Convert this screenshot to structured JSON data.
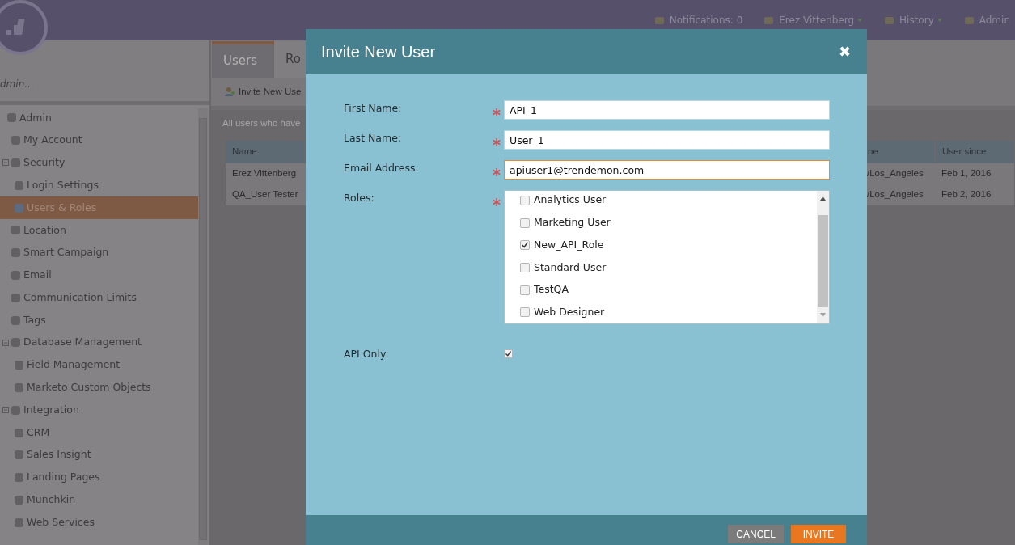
{
  "top_bar": {
    "items": [
      {
        "label": "Notifications: 0",
        "dropdown": false
      },
      {
        "label": "Erez Vittenberg",
        "dropdown": true
      },
      {
        "label": "History",
        "dropdown": true
      },
      {
        "label": "Admin",
        "dropdown": false
      }
    ]
  },
  "sidebar": {
    "search_placeholder": "dmin...",
    "tree": [
      {
        "label": "Admin",
        "selected": false,
        "children": [
          {
            "label": "My Account",
            "selected": false
          },
          {
            "label": "Security",
            "selected": false,
            "expanded": true,
            "children": [
              {
                "label": "Login Settings",
                "selected": false
              },
              {
                "label": "Users & Roles",
                "selected": true
              }
            ]
          },
          {
            "label": "Location",
            "selected": false
          },
          {
            "label": "Smart Campaign",
            "selected": false
          },
          {
            "label": "Email",
            "selected": false
          },
          {
            "label": "Communication Limits",
            "selected": false
          },
          {
            "label": "Tags",
            "selected": false
          },
          {
            "label": "Database Management",
            "selected": false,
            "expanded": true,
            "children": [
              {
                "label": "Field Management",
                "selected": false
              },
              {
                "label": "Marketo Custom Objects",
                "selected": false
              }
            ]
          },
          {
            "label": "Integration",
            "selected": false,
            "expanded": true,
            "children": [
              {
                "label": "CRM",
                "selected": false
              },
              {
                "label": "Sales Insight",
                "selected": false
              },
              {
                "label": "Landing Pages",
                "selected": false
              },
              {
                "label": "Munchkin",
                "selected": false
              },
              {
                "label": "Web Services",
                "selected": false
              }
            ]
          }
        ]
      }
    ]
  },
  "tabs": [
    {
      "label": "Users",
      "selected": true
    },
    {
      "label": "Ro",
      "selected": false
    }
  ],
  "toolbar": {
    "invite_button": "Invite New Use"
  },
  "description": "All users who have",
  "table": {
    "columns": [
      "Name",
      "ne",
      "User since"
    ],
    "rows": [
      [
        "Erez Vittenberg",
        "/Los_Angeles",
        "Feb 1, 2016"
      ],
      [
        "QA_User Tester",
        "/Los_Angeles",
        "Feb 2, 2016"
      ]
    ]
  },
  "dialog": {
    "title": "Invite New User",
    "close": "✖",
    "fields": [
      {
        "label": "First Name:",
        "required": true,
        "value": "API_1",
        "focused": false
      },
      {
        "label": "Last Name:",
        "required": true,
        "value": "User_1",
        "focused": false
      },
      {
        "label": "Email Address:",
        "required": true,
        "value": "apiuser1@trendemon.com",
        "focused": true
      }
    ],
    "roles": {
      "label": "Roles:",
      "required": true,
      "options": [
        {
          "label": "Analytics User",
          "checked": false
        },
        {
          "label": "Marketing User",
          "checked": false
        },
        {
          "label": "New_API_Role",
          "checked": true
        },
        {
          "label": "Standard User",
          "checked": false
        },
        {
          "label": "TestQA",
          "checked": false
        },
        {
          "label": "Web Designer",
          "checked": false
        }
      ]
    },
    "api_only": {
      "label": "API Only:",
      "checked": true
    },
    "buttons": [
      {
        "label": "CANCEL",
        "kind": "secondary"
      },
      {
        "label": "INVITE",
        "kind": "primary"
      }
    ]
  }
}
